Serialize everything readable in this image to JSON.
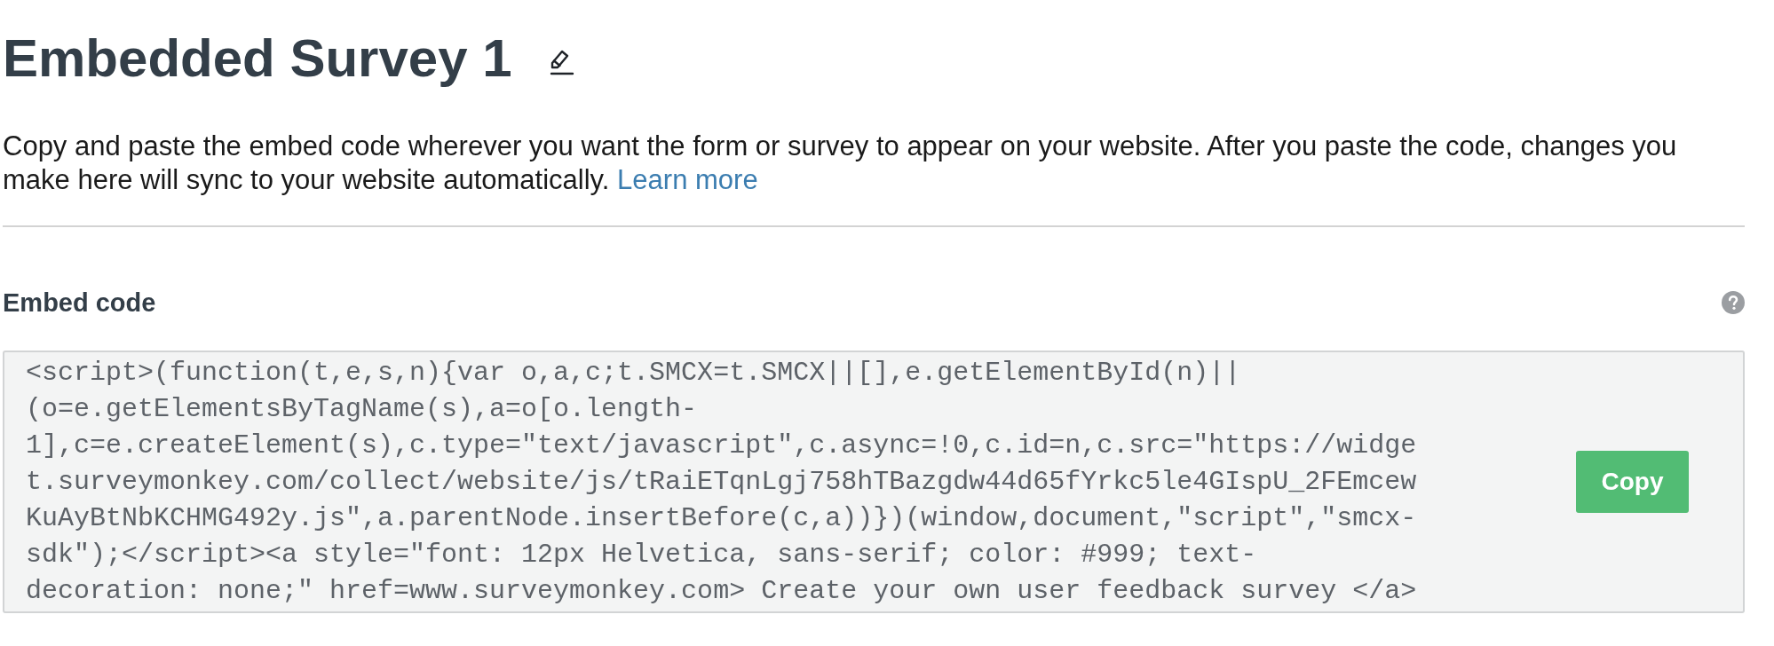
{
  "title": "Embedded Survey 1",
  "description": {
    "text": "Copy and paste the embed code wherever you want the form or survey to appear on your website. After you paste the code, changes you make here will sync to your website automatically.",
    "link": "Learn more"
  },
  "embed_code": {
    "label": "Embed code",
    "lines": [
      "<script>(function(t,e,s,n){var o,a,c;t.SMCX=t.SMCX||[],e.getElementById(n)||",
      "(o=e.getElementsByTagName(s),a=o[o.length-",
      "1],c=e.createElement(s),c.type=\"text/javascript\",c.async=!0,c.id=n,c.src=\"https://widge",
      "t.surveymonkey.com/collect/website/js/tRaiETqnLgj758hTBazgdw44d65fYrkc5le4GIspU_2FEmcew",
      "KuAyBtNbKCHMG492y.js\",a.parentNode.insertBefore(c,a))})(window,document,\"script\",\"smcx-",
      "sdk\");</script><a style=\"font: 12px Helvetica, sans-serif; color: #999; text-",
      "decoration: none;\" href=www.surveymonkey.com> Create your own user feedback survey </a>"
    ],
    "copy_button": "Copy"
  }
}
